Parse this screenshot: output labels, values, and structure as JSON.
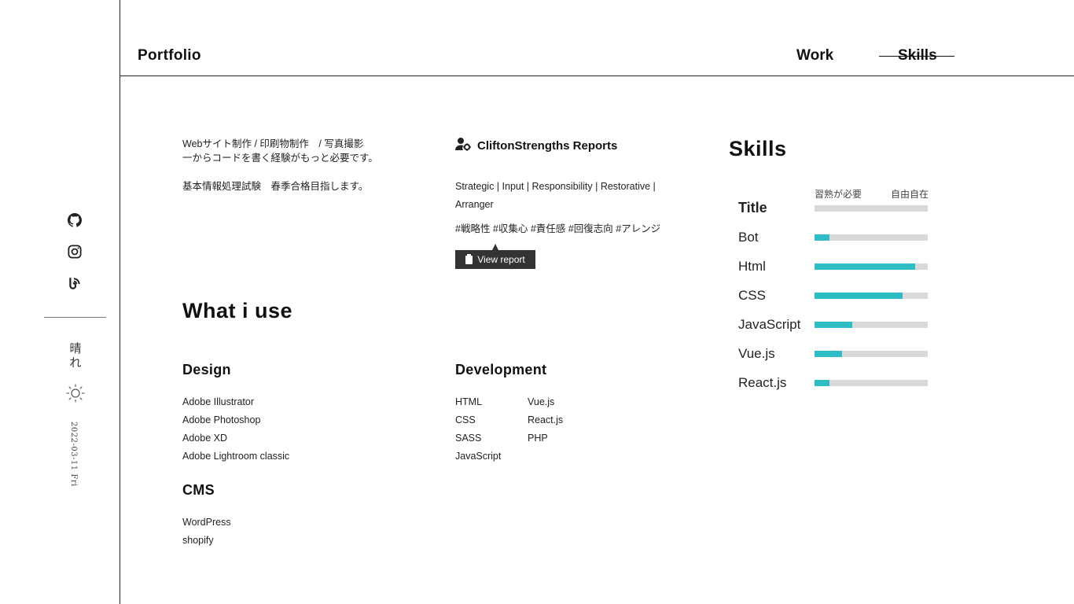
{
  "header": {
    "brand": "Portfolio",
    "nav": {
      "work": "Work",
      "skills": "Skills"
    }
  },
  "sidebar": {
    "icons": [
      "github-icon",
      "instagram-icon",
      "blog-icon"
    ],
    "weather": "晴れ",
    "weather_icon": "sun-icon",
    "date": "2022-03-11 Fri"
  },
  "intro": {
    "line1": "Webサイト制作 / 印刷物制作　/ 写真撮影",
    "line2": "一からコードを書く経験がもっと必要です。",
    "line3": "基本情報処理試験　春季合格目指します。"
  },
  "clifton": {
    "title": "CliftonStrengths Reports",
    "strengths": "Strategic | Input | Responsibility | Restorative | Arranger",
    "tags": "#戦略性 #収集心 #責任感 #回復志向 #アレンジ",
    "button": "View report"
  },
  "what_i_use": {
    "title": "What i use",
    "design": {
      "heading": "Design",
      "items": [
        "Adobe Illustrator",
        "Adobe Photoshop",
        "Adobe XD",
        "Adobe Lightroom classic"
      ]
    },
    "cms": {
      "heading": "CMS",
      "items": [
        "WordPress",
        "shopify"
      ]
    },
    "development": {
      "heading": "Development",
      "col1": [
        "HTML",
        "CSS",
        "SASS",
        "JavaScript"
      ],
      "col2": [
        "Vue.js",
        "React.js",
        "PHP"
      ]
    }
  },
  "skills": {
    "title": "Skills",
    "scale_low": "習熟が必要",
    "scale_high": "自由自在",
    "accent_color": "#2fbcc4",
    "track_color": "#d9d9d9",
    "items": [
      {
        "label": "Title",
        "level": 0
      },
      {
        "label": "Bot",
        "level": 0.13
      },
      {
        "label": "Html",
        "level": 0.89
      },
      {
        "label": "CSS",
        "level": 0.78
      },
      {
        "label": "JavaScript",
        "level": 0.33
      },
      {
        "label": "Vue.js",
        "level": 0.24
      },
      {
        "label": "React.js",
        "level": 0.13
      }
    ]
  }
}
